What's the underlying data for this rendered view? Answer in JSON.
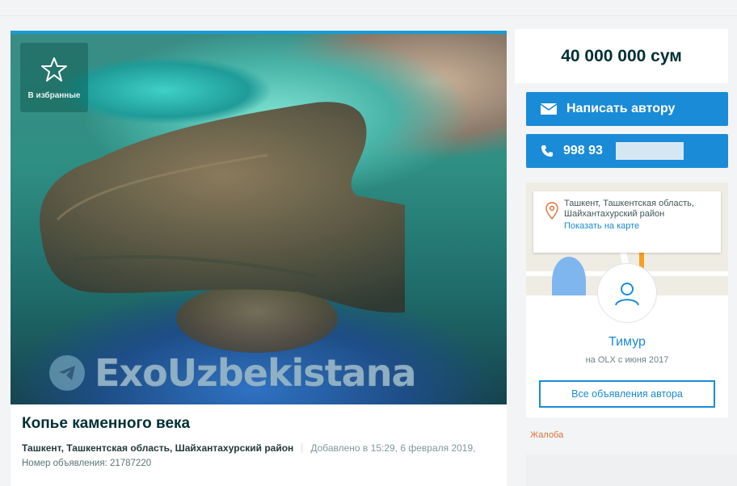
{
  "favorite": {
    "label": "В избранные",
    "icon": "star-icon"
  },
  "watermark": {
    "text": "ExoUzbekistana",
    "icon": "telegram-icon"
  },
  "ad": {
    "title": "Копье каменного века",
    "location": "Ташкент, Ташкентская область, Шайхантахурский район",
    "added": "Добавлено в 15:29, 6 февраля 2019,",
    "number": "Номер объявления: 21787220"
  },
  "price": "40 000 000 сум",
  "actions": {
    "message_label": "Написать автору",
    "message_icon": "envelope-icon",
    "phone_label": "998 93",
    "phone_icon": "phone-icon"
  },
  "seller": {
    "address": "Ташкент, Ташкентская область, Шайхантахурский район",
    "map_link": "Показать на карте",
    "name": "Тимур",
    "since": "на OLX с июня 2017",
    "all_ads": "Все объявления автора"
  },
  "complain": "Жалоба",
  "colors": {
    "accent": "#1a8bd6",
    "text": "#002f34",
    "complain": "#e0713b"
  }
}
